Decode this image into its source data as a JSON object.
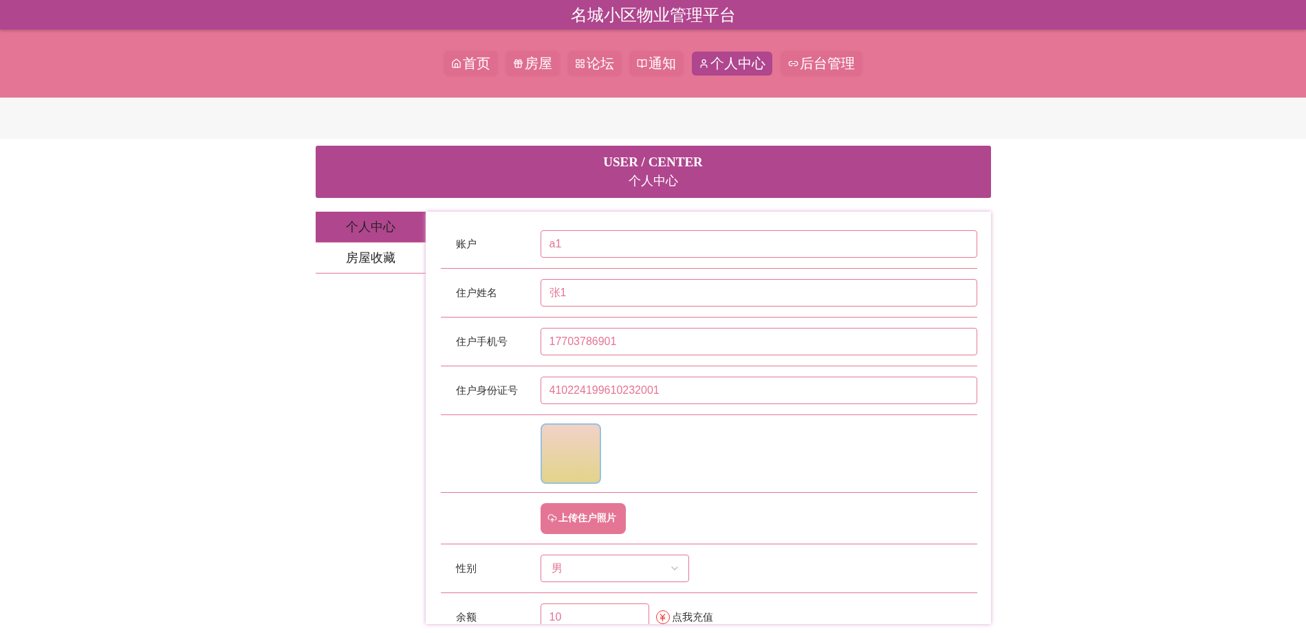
{
  "site_title": "名城小区物业管理平台",
  "nav": [
    {
      "label": "首页",
      "selected": false
    },
    {
      "label": "房屋",
      "selected": false
    },
    {
      "label": "论坛",
      "selected": false
    },
    {
      "label": "通知",
      "selected": false
    },
    {
      "label": "个人中心",
      "selected": true
    },
    {
      "label": "后台管理",
      "selected": false
    }
  ],
  "banner": {
    "title_en": "USER / CENTER",
    "title_cn": "个人中心"
  },
  "sidebar": [
    {
      "label": "个人中心",
      "selected": true
    },
    {
      "label": "房屋收藏",
      "selected": false
    }
  ],
  "form": [
    {
      "kind": "text",
      "label": "账户",
      "value": "a1"
    },
    {
      "kind": "text",
      "label": "住户姓名",
      "value": "张1"
    },
    {
      "kind": "text",
      "label": "住户手机号",
      "value": "17703786901"
    },
    {
      "kind": "text",
      "label": "住户身份证号",
      "value": "410224199610232001"
    },
    {
      "kind": "image"
    },
    {
      "kind": "upload",
      "button": "上传住户照片"
    },
    {
      "kind": "select",
      "label": "性别",
      "value": "男"
    },
    {
      "kind": "balance",
      "label": "余额",
      "value": "10",
      "link": "点我充值"
    }
  ]
}
